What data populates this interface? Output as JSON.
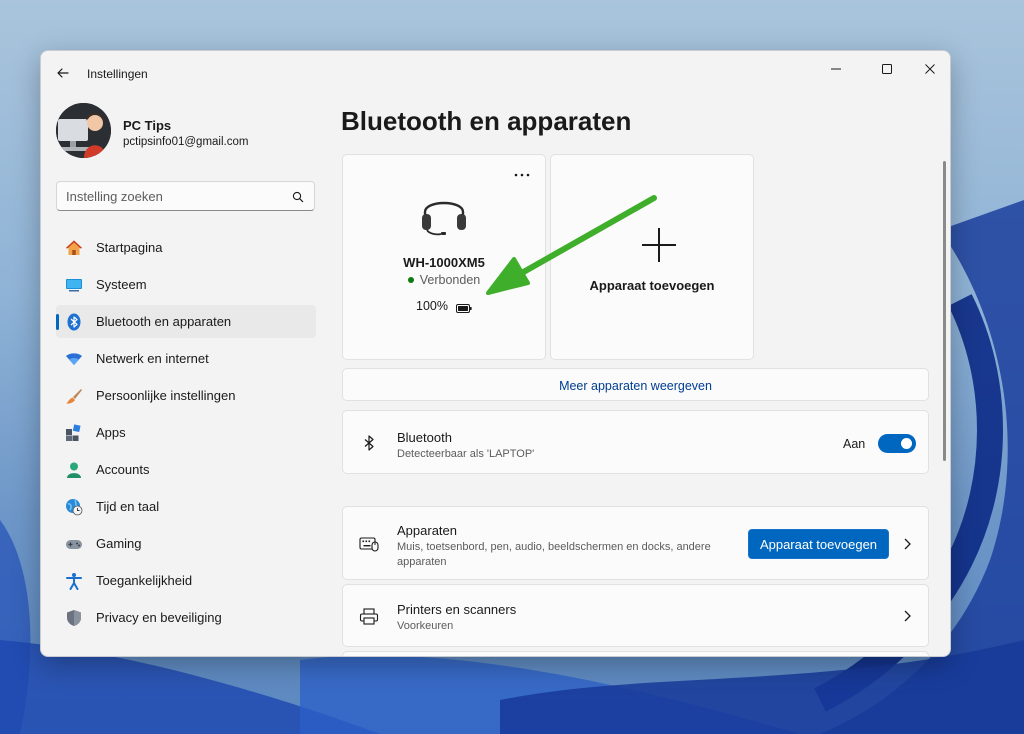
{
  "window": {
    "title": "Instellingen"
  },
  "profile": {
    "name": "PC Tips",
    "email": "pctipsinfo01@gmail.com"
  },
  "search": {
    "placeholder": "Instelling zoeken"
  },
  "sidebar": {
    "items": [
      {
        "label": "Startpagina",
        "icon": "home-icon"
      },
      {
        "label": "Systeem",
        "icon": "monitor-icon"
      },
      {
        "label": "Bluetooth en apparaten",
        "icon": "bluetooth-icon",
        "active": true
      },
      {
        "label": "Netwerk en internet",
        "icon": "wifi-icon"
      },
      {
        "label": "Persoonlijke instellingen",
        "icon": "brush-icon"
      },
      {
        "label": "Apps",
        "icon": "apps-icon"
      },
      {
        "label": "Accounts",
        "icon": "person-icon"
      },
      {
        "label": "Tijd en taal",
        "icon": "globe-clock-icon"
      },
      {
        "label": "Gaming",
        "icon": "gamepad-icon"
      },
      {
        "label": "Toegankelijkheid",
        "icon": "accessibility-icon"
      },
      {
        "label": "Privacy en beveiliging",
        "icon": "shield-icon"
      }
    ]
  },
  "main": {
    "title": "Bluetooth en apparaten",
    "device": {
      "name": "WH-1000XM5",
      "status": "Verbonden",
      "battery": "100%"
    },
    "add_device_card": {
      "label": "Apparaat toevoegen"
    },
    "more_devices_link": "Meer apparaten weergeven",
    "bluetooth": {
      "title": "Bluetooth",
      "subtitle": "Detecteerbaar als 'LAPTOP'",
      "state_label": "Aan",
      "enabled": true
    },
    "devices": {
      "title": "Apparaten",
      "subtitle_line1": "Muis, toetsenbord, pen, audio, beeldschermen en docks, andere",
      "subtitle_line2": "apparaten",
      "button": "Apparaat toevoegen"
    },
    "printers": {
      "title": "Printers en scanners",
      "subtitle": "Voorkeuren"
    }
  },
  "colors": {
    "accent": "#0067c0",
    "annotation_arrow": "#3fae2a",
    "connected_dot": "#0f7b0f"
  }
}
